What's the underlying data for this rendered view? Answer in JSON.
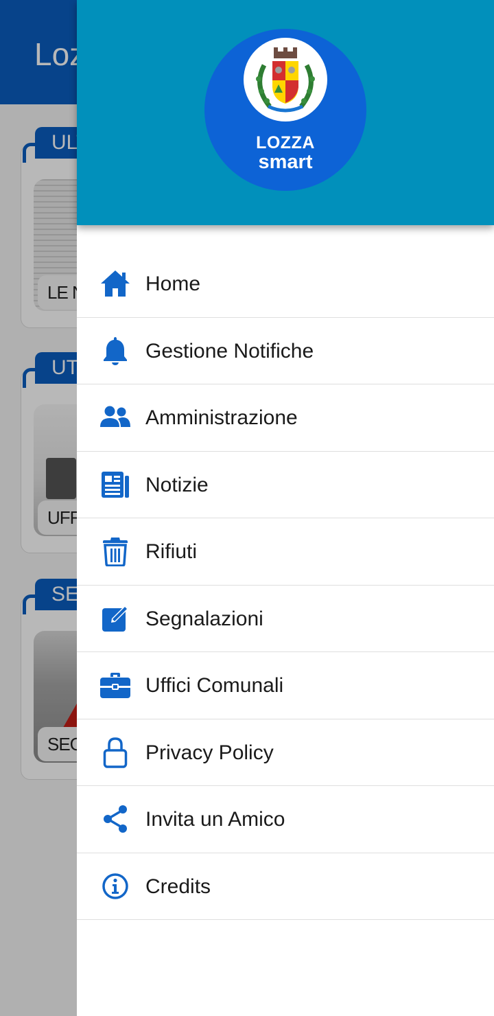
{
  "background": {
    "app_title": "Lozza",
    "cards": [
      {
        "tag": "ULTIME NOTIZIE",
        "caption": "LE NOTIZIE"
      },
      {
        "tag": "UTILITÀ",
        "caption": "UFFICI COMUNALI"
      },
      {
        "tag": "SEGNALAZIONI",
        "caption": "SEGNALAZIONI"
      }
    ]
  },
  "drawer": {
    "logo_line1": "LOZZA",
    "logo_line2": "smart",
    "menu": [
      {
        "label": "Home",
        "icon": "home-icon"
      },
      {
        "label": "Gestione Notifiche",
        "icon": "bell-icon"
      },
      {
        "label": "Amministrazione",
        "icon": "users-icon"
      },
      {
        "label": "Notizie",
        "icon": "newspaper-icon"
      },
      {
        "label": "Rifiuti",
        "icon": "trash-icon"
      },
      {
        "label": "Segnalazioni",
        "icon": "edit-icon"
      },
      {
        "label": "Uffici Comunali",
        "icon": "briefcase-icon"
      },
      {
        "label": "Privacy Policy",
        "icon": "lock-icon"
      },
      {
        "label": "Invita un Amico",
        "icon": "share-icon"
      },
      {
        "label": "Credits",
        "icon": "info-icon"
      }
    ]
  },
  "colors": {
    "accent": "#0a5dbf",
    "drawer_header": "#0190bb",
    "logo_circle": "#0d63d6",
    "icon": "#1266c8"
  }
}
